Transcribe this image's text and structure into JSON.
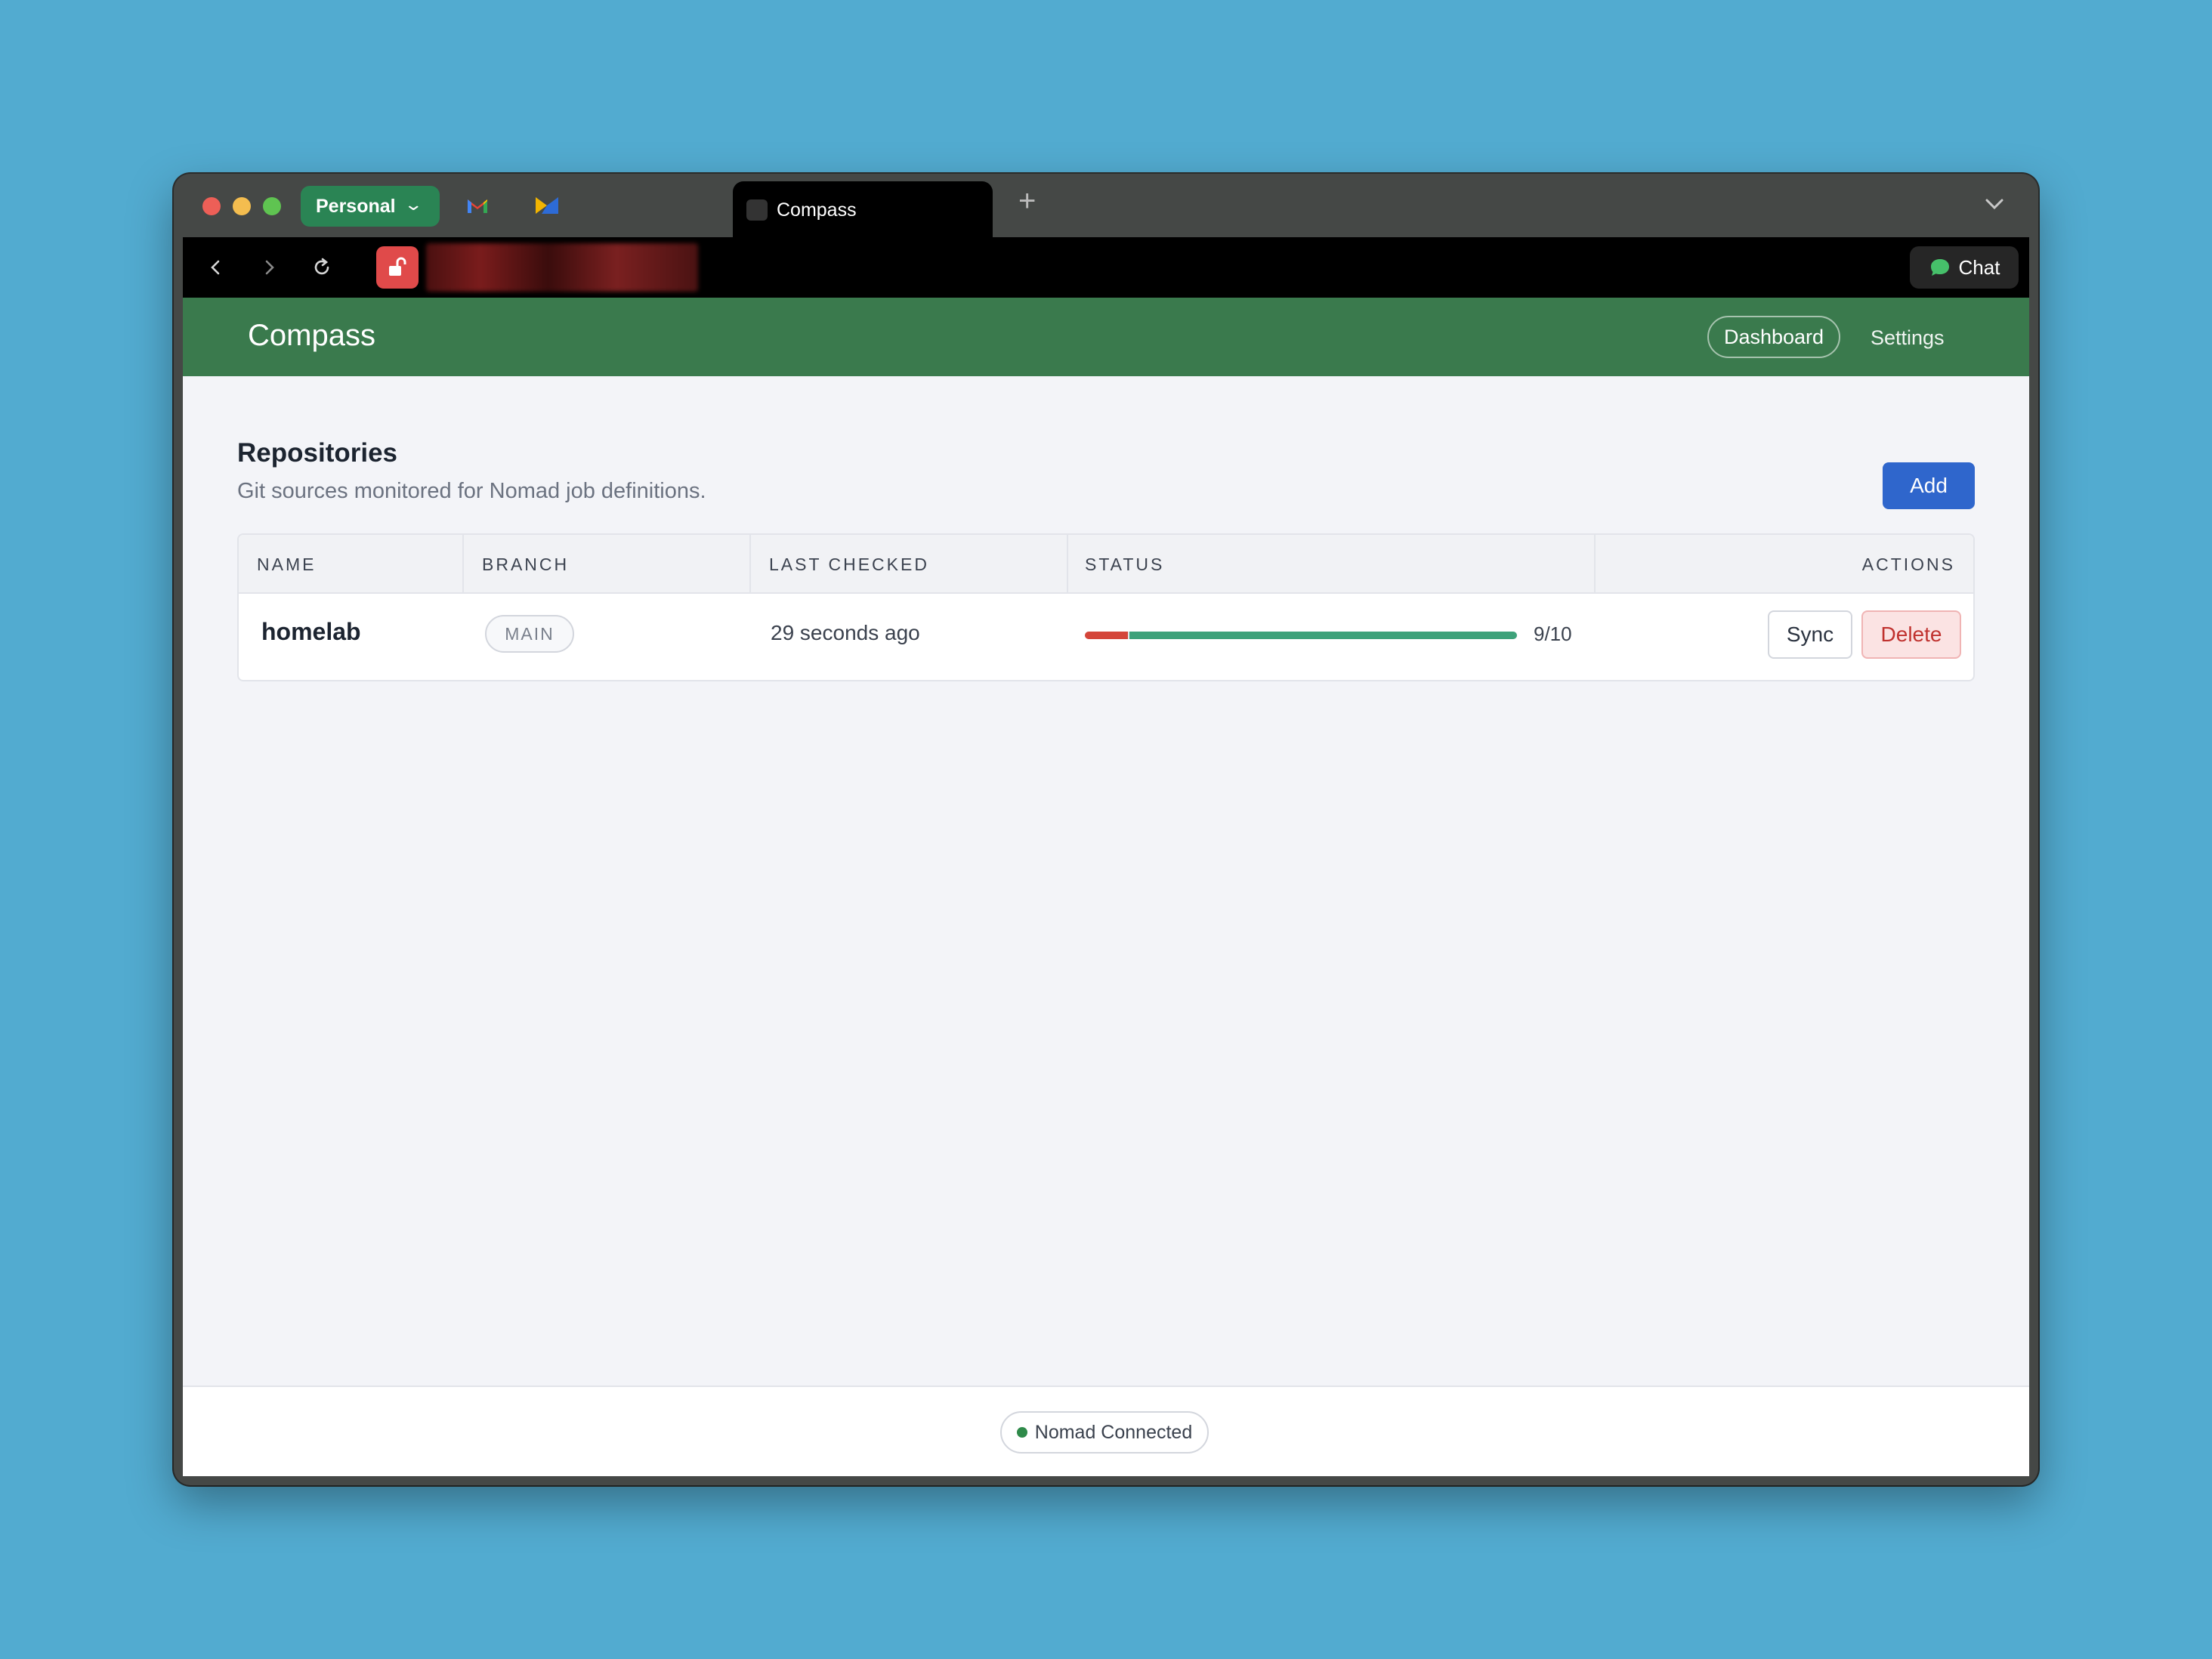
{
  "browser": {
    "profile_label": "Personal",
    "active_tab_title": "Compass",
    "new_tab_label": "+",
    "chat_label": "Chat"
  },
  "app": {
    "brand": "Compass",
    "nav": {
      "dashboard": "Dashboard",
      "settings": "Settings"
    }
  },
  "repositories": {
    "title": "Repositories",
    "subtitle": "Git sources monitored for Nomad job definitions.",
    "add_label": "Add",
    "columns": [
      "NAME",
      "BRANCH",
      "LAST CHECKED",
      "STATUS",
      "ACTIONS"
    ],
    "rows": [
      {
        "name": "homelab",
        "branch": "MAIN",
        "last_checked": "29 seconds ago",
        "status_text": "9/10",
        "status_failed_fraction": 0.1,
        "status_ok_fraction": 0.9,
        "sync_label": "Sync",
        "delete_label": "Delete"
      }
    ]
  },
  "footer": {
    "connection_status": "Nomad Connected"
  },
  "colors": {
    "header_green": "#3a7a4d",
    "accent_blue": "#2f66cc",
    "status_fail": "#d4453a",
    "status_ok": "#3ea27a",
    "danger": "#c0322f"
  }
}
